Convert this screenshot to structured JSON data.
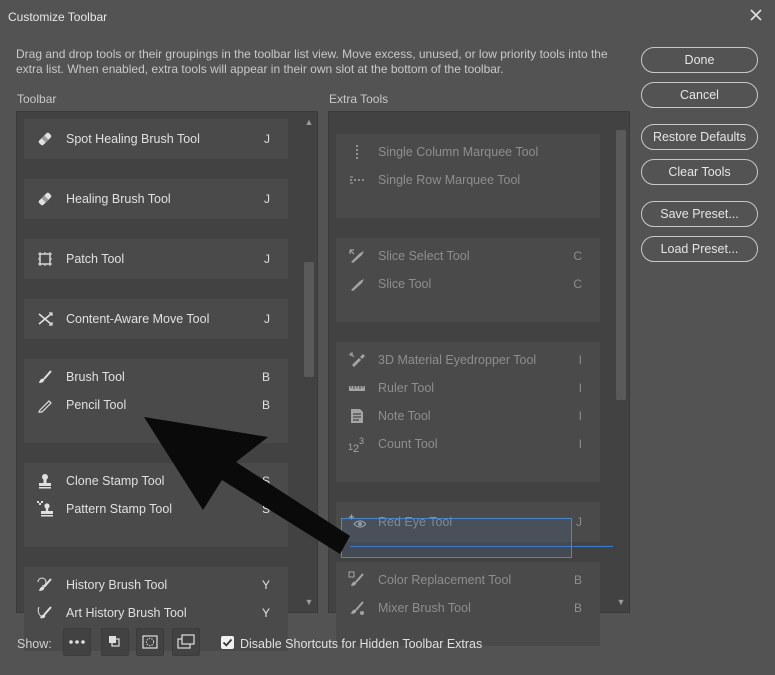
{
  "window": {
    "title": "Customize Toolbar"
  },
  "description": "Drag and drop tools or their groupings in the toolbar list view. Move excess, unused, or low priority tools into the extra list. When enabled, extra tools will appear in their own slot at the bottom of the toolbar.",
  "toolbar": {
    "label": "Toolbar",
    "groups": [
      {
        "tools": [
          {
            "name": "Spot Healing Brush Tool",
            "key": "J",
            "icon": "bandage-icon"
          }
        ]
      },
      {
        "tools": [
          {
            "name": "Healing Brush Tool",
            "key": "J",
            "icon": "bandage-icon"
          }
        ]
      },
      {
        "tools": [
          {
            "name": "Patch Tool",
            "key": "J",
            "icon": "patch-icon"
          }
        ]
      },
      {
        "tools": [
          {
            "name": "Content-Aware Move Tool",
            "key": "J",
            "icon": "cross-arrows-icon"
          }
        ]
      },
      {
        "tools": [
          {
            "name": "Brush Tool",
            "key": "B",
            "icon": "brush-icon"
          },
          {
            "name": "Pencil Tool",
            "key": "B",
            "icon": "pencil-icon"
          }
        ]
      },
      {
        "tools": [
          {
            "name": "Clone Stamp Tool",
            "key": "S",
            "icon": "stamp-icon"
          },
          {
            "name": "Pattern Stamp Tool",
            "key": "S",
            "icon": "pattern-stamp-icon"
          }
        ]
      },
      {
        "tools": [
          {
            "name": "History Brush Tool",
            "key": "Y",
            "icon": "history-brush-icon"
          },
          {
            "name": "Art History Brush Tool",
            "key": "Y",
            "icon": "art-history-brush-icon"
          }
        ]
      }
    ]
  },
  "extra": {
    "label": "Extra Tools",
    "groups": [
      {
        "tools": [
          {
            "name": "Single Column Marquee Tool",
            "key": "",
            "icon": "column-marquee-icon"
          },
          {
            "name": "Single Row Marquee Tool",
            "key": "",
            "icon": "row-marquee-icon"
          }
        ]
      },
      {
        "tools": [
          {
            "name": "Slice Select Tool",
            "key": "C",
            "icon": "slice-select-icon"
          },
          {
            "name": "Slice Tool",
            "key": "C",
            "icon": "slice-icon"
          }
        ]
      },
      {
        "tools": [
          {
            "name": "3D Material Eyedropper Tool",
            "key": "I",
            "icon": "eyedropper-icon"
          },
          {
            "name": "Ruler Tool",
            "key": "I",
            "icon": "ruler-icon"
          },
          {
            "name": "Note Tool",
            "key": "I",
            "icon": "note-icon"
          },
          {
            "name": "Count Tool",
            "key": "I",
            "icon": "count-icon"
          }
        ]
      },
      {
        "tools": [
          {
            "name": "Red Eye Tool",
            "key": "J",
            "icon": "red-eye-icon"
          }
        ]
      },
      {
        "tools": [
          {
            "name": "Color Replacement Tool",
            "key": "B",
            "icon": "color-replace-icon"
          },
          {
            "name": "Mixer Brush Tool",
            "key": "B",
            "icon": "mixer-brush-icon"
          }
        ]
      }
    ]
  },
  "buttons": {
    "done": "Done",
    "cancel": "Cancel",
    "restore": "Restore Defaults",
    "clear": "Clear Tools",
    "save_preset": "Save Preset...",
    "load_preset": "Load Preset..."
  },
  "show": {
    "label": "Show:",
    "checkbox_label": "Disable Shortcuts for Hidden Toolbar Extras",
    "checkbox_checked": true
  },
  "colors": {
    "background": "#535353",
    "panel": "#424242",
    "group": "#4a4a4a",
    "drag_highlight": "#3d7bd0"
  }
}
